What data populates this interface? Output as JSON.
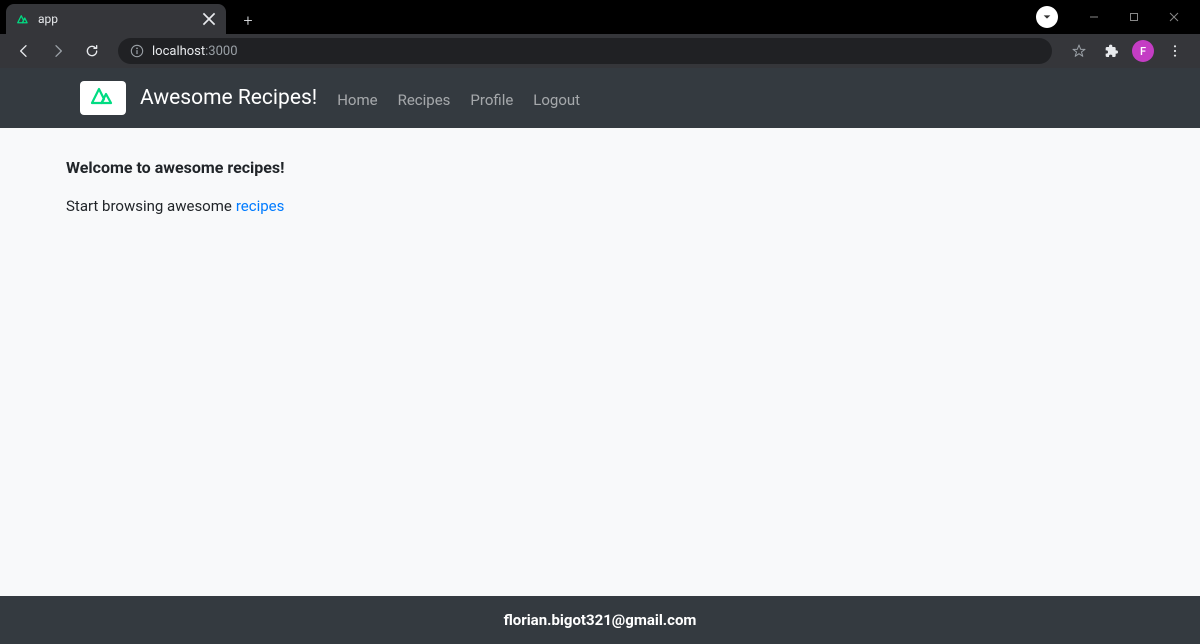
{
  "browser": {
    "tab_title": "app",
    "url_host": "localhost",
    "url_port": ":3000",
    "avatar_letter": "F"
  },
  "navbar": {
    "brand": "Awesome Recipes!",
    "links": {
      "home": "Home",
      "recipes": "Recipes",
      "profile": "Profile",
      "logout": "Logout"
    }
  },
  "main": {
    "heading": "Welcome to awesome recipes!",
    "subtext_prefix": "Start browsing awesome",
    "recipes_link": "recipes"
  },
  "footer": {
    "email": "florian.bigot321@gmail.com"
  }
}
